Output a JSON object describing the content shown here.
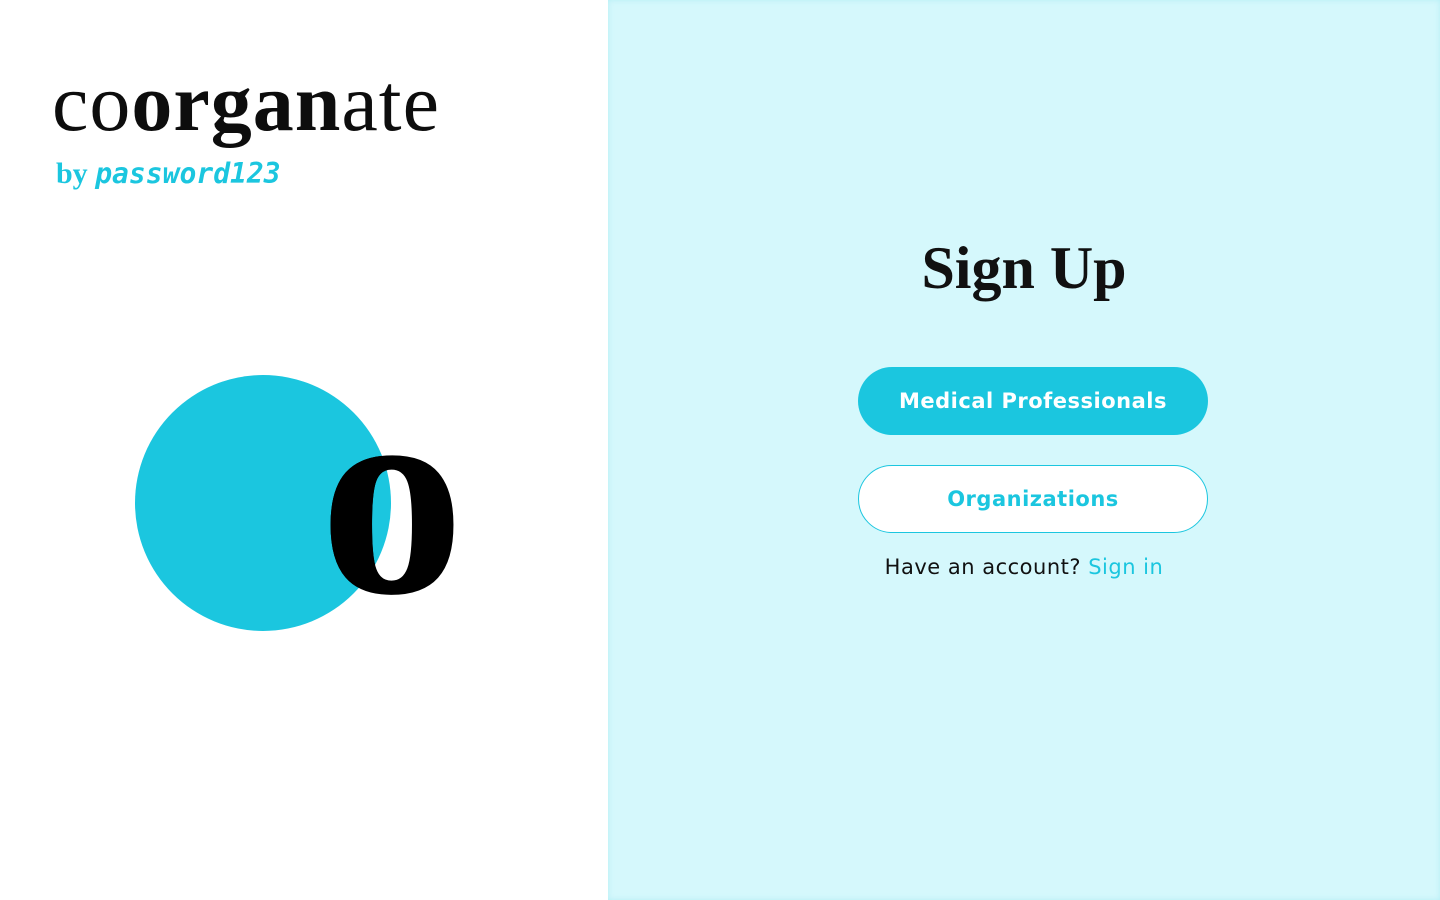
{
  "brand": {
    "wordmark_prefix": "co",
    "wordmark_bold": "organ",
    "wordmark_suffix": "ate",
    "byline_by": "by",
    "byline_name": "password123",
    "mark_letter": "o"
  },
  "signup": {
    "title": "Sign Up",
    "medical_button": "Medical Professionals",
    "organizations_button": "Organizations",
    "have_account_text": "Have an account?",
    "sign_in_link": "Sign in"
  },
  "colors": {
    "accent": "#1bc6df",
    "right_panel_bg": "#d5f8fc",
    "text": "#111111",
    "background": "#ffffff"
  }
}
